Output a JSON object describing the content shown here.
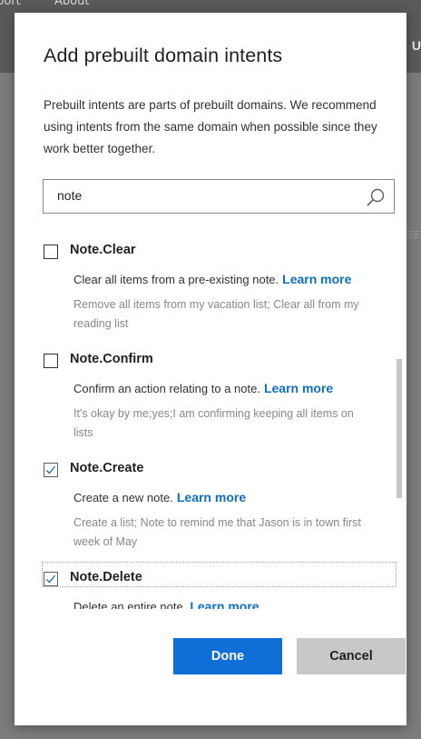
{
  "background": {
    "nav_items": [
      "port",
      "About"
    ],
    "right_label": "U",
    "right_fragment": "ce"
  },
  "dialog": {
    "title": "Add prebuilt domain intents",
    "description": "Prebuilt intents are parts of prebuilt domains. We recommend using intents from the same domain when possible since they work better together.",
    "search": {
      "value": "note",
      "icon": "search-icon"
    },
    "learn_more": "Learn more",
    "intents": [
      {
        "name": "Note.Clear",
        "checked": false,
        "description": "Clear all items from a pre-existing note.",
        "examples": "Remove all items from my vacation list; Clear all from my reading list"
      },
      {
        "name": "Note.Confirm",
        "checked": false,
        "description": "Confirm an action relating to a note.",
        "examples": "It's okay by me;yes;I am confirming keeping all items on lists"
      },
      {
        "name": "Note.Create",
        "checked": true,
        "description": "Create a new note.",
        "examples": "Create a list; Note to remind me that Jason is in town first week of May"
      },
      {
        "name": "Note.Delete",
        "checked": true,
        "description": "Delete an entire note.",
        "examples": ""
      }
    ],
    "buttons": {
      "done": "Done",
      "cancel": "Cancel"
    },
    "colors": {
      "primary": "#0f6fd6",
      "link": "#106ebe",
      "secondary": "#c8c8c8"
    }
  }
}
